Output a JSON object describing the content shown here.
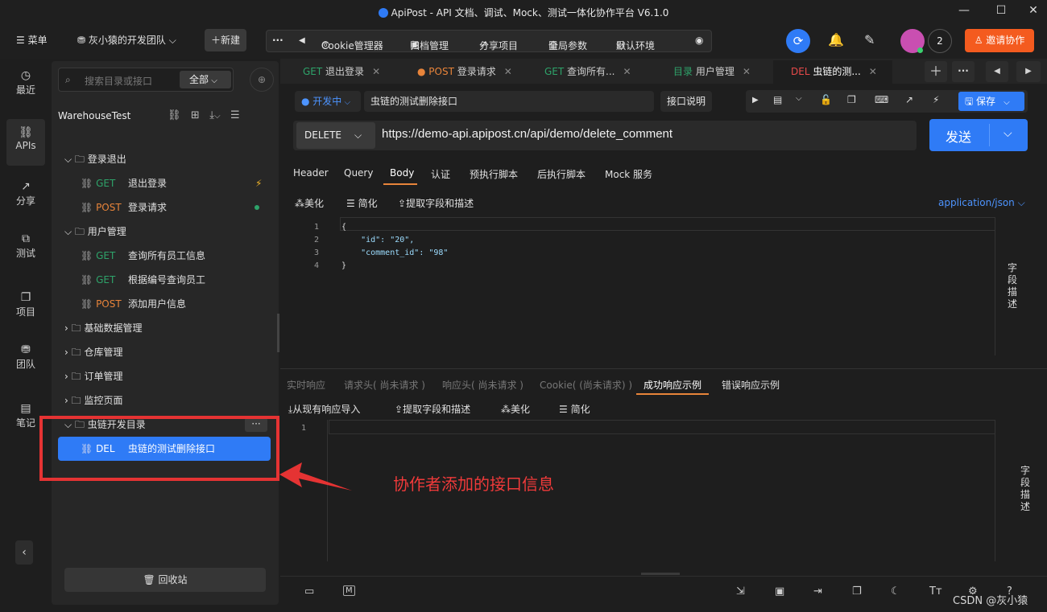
{
  "window": {
    "title": "ApiPost - API 文档、调试、Mock、测试一体化协作平台 V6.1.0",
    "controls": [
      "—",
      "☐",
      "✕"
    ]
  },
  "topbar": {
    "menu": "菜单",
    "team": "灰小猿的开发团队",
    "new": "新建",
    "more": "···",
    "prev": "◀",
    "cookie": "Cookie管理器",
    "archive": "归档管理",
    "share": "分享项目",
    "global_params": "全局参数",
    "env": "默认环境",
    "user_count": "2",
    "invite": "邀请协作"
  },
  "rail": [
    {
      "icon": "clock-icon",
      "label": "最近"
    },
    {
      "icon": "link-icon",
      "label": "APIs"
    },
    {
      "icon": "share-icon",
      "label": "分享"
    },
    {
      "icon": "test-icon",
      "label": "测试"
    },
    {
      "icon": "project-icon",
      "label": "项目"
    },
    {
      "icon": "team-icon",
      "label": "团队"
    },
    {
      "icon": "note-icon",
      "label": "笔记"
    }
  ],
  "sidebar": {
    "search_placeholder": "搜索目录或接口",
    "filter": "全部",
    "project": "WarehouseTest",
    "tree": [
      {
        "type": "folder",
        "label": "登录退出"
      },
      {
        "type": "api",
        "method": "GET",
        "label": "退出登录"
      },
      {
        "type": "api",
        "method": "POST",
        "label": "登录请求"
      },
      {
        "type": "folder",
        "label": "用户管理"
      },
      {
        "type": "api",
        "method": "GET",
        "label": "查询所有员工信息"
      },
      {
        "type": "api",
        "method": "GET",
        "label": "根据编号查询员工"
      },
      {
        "type": "api",
        "method": "POST",
        "label": "添加用户信息"
      },
      {
        "type": "folder",
        "label": "基础数据管理"
      },
      {
        "type": "folder",
        "label": "仓库管理"
      },
      {
        "type": "folder",
        "label": "订单管理"
      },
      {
        "type": "folder",
        "label": "监控页面"
      },
      {
        "type": "folder",
        "label": "虫链开发目录"
      },
      {
        "type": "api",
        "method": "DEL",
        "label": "虫链的测试删除接口"
      }
    ],
    "recycle": "回收站"
  },
  "tabs": [
    {
      "method": "GET",
      "label": "退出登录"
    },
    {
      "method": "POST",
      "label": "登录请求"
    },
    {
      "method": "GET",
      "label": "查询所有..."
    },
    {
      "method": "目录",
      "label": "用户管理"
    },
    {
      "method": "DEL",
      "label": "虫链的测..."
    }
  ],
  "request": {
    "status": "开发中",
    "name": "虫链的测试删除接口",
    "doc_btn": "接口说明",
    "save": "保存",
    "method": "DELETE",
    "url": "https://demo-api.apipost.cn/api/demo/delete_comment",
    "send": "发送",
    "subtabs": [
      "Header",
      "Query",
      "Body",
      "认证",
      "预执行脚本",
      "后执行脚本",
      "Mock 服务"
    ],
    "body_tools": [
      "美化",
      "简化",
      "提取字段和描述"
    ],
    "content_type": "application/json",
    "body_lines": [
      "{",
      "    \"id\": \"20\",",
      "    \"comment_id\": \"98\"",
      "}"
    ],
    "line_numbers": [
      "1",
      "2",
      "3",
      "4"
    ],
    "field_desc": "字段描述"
  },
  "response": {
    "tabs": [
      "实时响应",
      "请求头( 尚未请求 )",
      "响应头( 尚未请求 )",
      "Cookie( (尚未请求) )",
      "成功响应示例",
      "错误响应示例"
    ],
    "tools": [
      "从现有响应导入",
      "提取字段和描述",
      "美化",
      "简化"
    ],
    "line_number": "1",
    "field_desc": "字段描述"
  },
  "annotation": "协作者添加的接口信息",
  "watermark": "CSDN @灰小猿",
  "colors": {
    "accent": "#2f7bf6",
    "get": "#2ea36a",
    "post": "#e8843a",
    "del": "#e84a4a",
    "highlight": "#e53333"
  }
}
